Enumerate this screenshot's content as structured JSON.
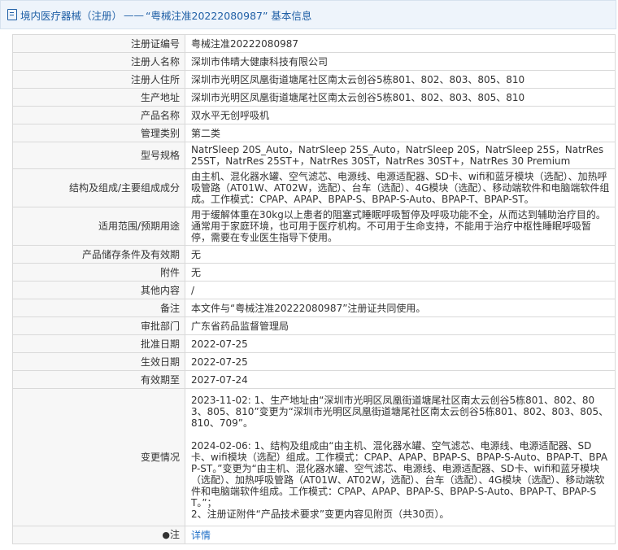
{
  "header": {
    "breadcrumb": "境内医疗器械（注册）",
    "separator": "——",
    "title": "“粤械注准20222080987” 基本信息"
  },
  "rows": [
    {
      "label": "注册证编号",
      "value": "粤械注准20222080987"
    },
    {
      "label": "注册人名称",
      "value": "深圳市伟晴大健康科技有限公司"
    },
    {
      "label": "注册人住所",
      "value": "深圳市光明区凤凰街道塘尾社区南太云创谷5栋801、802、803、805、810"
    },
    {
      "label": "生产地址",
      "value": "深圳市光明区凤凰街道塘尾社区南太云创谷5栋801、802、803、805、810"
    },
    {
      "label": "产品名称",
      "value": "双水平无创呼吸机"
    },
    {
      "label": "管理类别",
      "value": "第二类"
    },
    {
      "label": "型号规格",
      "value": "NatrSleep 20S_Auto，NatrSleep 25S_Auto，NatrSleep 20S，NatrSleep 25S，NatrRes 25ST，NatrRes 25ST+，NatrRes 30ST，NatrRes 30ST+，NatrRes 30 Premium"
    },
    {
      "label": "结构及组成/主要组成成分",
      "value": "由主机、混化器水罐、空气滤芯、电源线、电源适配器、SD卡、wifi和蓝牙模块（选配）、加热呼吸管路（AT01W、AT02W，选配）、台车（选配）、4G模块（选配）、移动端软件和电脑端软件组成。工作模式：CPAP、APAP、BPAP-S、BPAP-S-Auto、BPAP-T、BPAP-ST。"
    },
    {
      "label": "适用范围/预期用途",
      "value": "用于缓解体重在30kg以上患者的阻塞式睡眠呼吸暂停及呼吸功能不全，从而达到辅助治疗目的。通常用于家庭环境，也可用于医疗机构。不可用于生命支持，不能用于治疗中枢性睡眠呼吸暂停，需要在专业医生指导下使用。"
    },
    {
      "label": "产品储存条件及有效期",
      "value": "无"
    },
    {
      "label": "附件",
      "value": "无"
    },
    {
      "label": "其他内容",
      "value": "/"
    },
    {
      "label": "备注",
      "value": "本文件与“粤械注准20222080987”注册证共同使用。"
    },
    {
      "label": "审批部门",
      "value": "广东省药品监督管理局"
    },
    {
      "label": "批准日期",
      "value": "2022-07-25"
    },
    {
      "label": "生效日期",
      "value": "2022-07-25"
    },
    {
      "label": "有效期至",
      "value": "2027-07-24"
    }
  ],
  "changes": {
    "label": "变更情况",
    "entry1": "2023-11-02: 1、生产地址由“深圳市光明区凤凰街道塘尾社区南太云创谷5栋801、802、803、805、810”变更为“深圳市光明区凤凰街道塘尾社区南太云创谷5栋801、802、803、805、810、709”。",
    "entry2": "2024-02-06: 1、结构及组成由“由主机、混化器水罐、空气滤芯、电源线、电源适配器、SD卡、wifi模块（选配）组成。工作模式：CPAP、APAP、BPAP-S、BPAP-S-Auto、BPAP-T、BPAP-ST。”变更为“由主机、混化器水罐、空气滤芯、电源线、电源适配器、SD卡、wifi和蓝牙模块（选配）、加热呼吸管路（AT01W、AT02W，选配）、台车（选配）、4G模块（选配）、移动端软件和电脑端软件组成。工作模式：CPAP、APAP、BPAP-S、BPAP-S-Auto、BPAP-T、BPAP-ST。”；",
    "entry3": "2、注册证附件“产品技术要求”变更内容见附页（共30页）。"
  },
  "note": {
    "label": "注",
    "icon": "pin-icon",
    "link": "详情"
  },
  "colors": {
    "header_text": "#1f5fa6",
    "link": "#1f6fc7",
    "border": "#d9d9d9"
  }
}
